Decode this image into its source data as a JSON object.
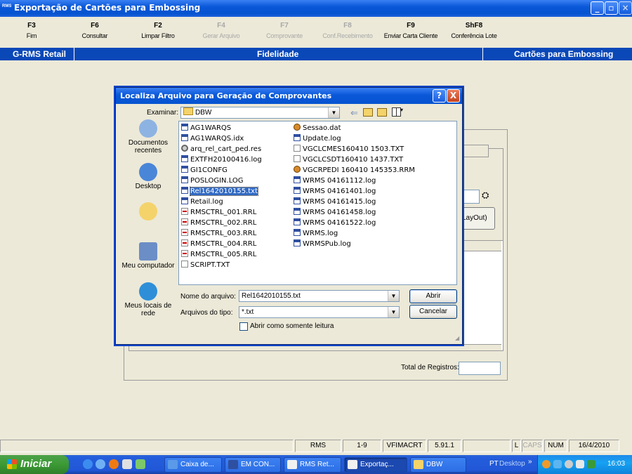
{
  "window": {
    "title": "Exportação de Cartões para Embossing",
    "logo": "RMS"
  },
  "function_keys": [
    {
      "key": "F3",
      "label": "Fim",
      "enabled": true
    },
    {
      "key": "F6",
      "label": "Consultar",
      "enabled": true
    },
    {
      "key": "F2",
      "label": "Limpar Filtro",
      "enabled": true
    },
    {
      "key": "F4",
      "label": "Gerar Arquivo",
      "enabled": false
    },
    {
      "key": "F7",
      "label": "Comprovante",
      "enabled": false
    },
    {
      "key": "F8",
      "label": "Conf.Recebimento",
      "enabled": false
    },
    {
      "key": "F9",
      "label": "Enviar Carta Cliente",
      "enabled": true
    },
    {
      "key": "ShF8",
      "label": "Conferência Lote",
      "enabled": true
    }
  ],
  "band": {
    "left": "G-RMS Retail",
    "center": "Fidelidade",
    "right": "Cartões para Embossing"
  },
  "background_form": {
    "layout_button": "LayOut)",
    "total_label": "Total de Registros:"
  },
  "dialog": {
    "title": "Localiza Arquivo para Geração de Comprovantes",
    "help": "?",
    "close": "X",
    "look_in_label": "Examinar:",
    "look_in_value": "DBW",
    "places": [
      {
        "label": "Documentos recentes",
        "icon": "recent-documents-icon"
      },
      {
        "label": "Desktop",
        "icon": "desktop-icon"
      },
      {
        "label": "",
        "icon": "my-documents-icon"
      },
      {
        "label": "Meu computador",
        "icon": "my-computer-icon"
      },
      {
        "label": "Meus locais de rede",
        "icon": "network-places-icon"
      }
    ],
    "files_col1": [
      {
        "name": "AG1WARQS",
        "icon": "log"
      },
      {
        "name": "AG1WARQS.idx",
        "icon": "log"
      },
      {
        "name": "arq_rel_cart_ped.res",
        "icon": "gear"
      },
      {
        "name": "EXTFH20100416.log",
        "icon": "log"
      },
      {
        "name": "GI1CONFG",
        "icon": "log"
      },
      {
        "name": "POSLOGIN.LOG",
        "icon": "log"
      },
      {
        "name": "Rel1642010155.txt",
        "icon": "log",
        "selected": true
      },
      {
        "name": "Retail.log",
        "icon": "log"
      },
      {
        "name": "RMSCTRL_001.RRL",
        "icon": "rrl"
      },
      {
        "name": "RMSCTRL_002.RRL",
        "icon": "rrl"
      },
      {
        "name": "RMSCTRL_003.RRL",
        "icon": "rrl"
      },
      {
        "name": "RMSCTRL_004.RRL",
        "icon": "rrl"
      },
      {
        "name": "RMSCTRL_005.RRL",
        "icon": "rrl"
      },
      {
        "name": "SCRIPT.TXT",
        "icon": "txt"
      }
    ],
    "files_col2": [
      {
        "name": "Sessao.dat",
        "icon": "fav"
      },
      {
        "name": "Update.log",
        "icon": "log"
      },
      {
        "name": "VGCLCMES160410 1503.TXT",
        "icon": "txt"
      },
      {
        "name": "VGCLCSDT160410 1437.TXT",
        "icon": "txt"
      },
      {
        "name": "VGCRPEDI 160410 145353.RRM",
        "icon": "fav"
      },
      {
        "name": "WRMS 04161112.log",
        "icon": "log"
      },
      {
        "name": "WRMS 04161401.log",
        "icon": "log"
      },
      {
        "name": "WRMS 04161415.log",
        "icon": "log"
      },
      {
        "name": "WRMS 04161458.log",
        "icon": "log"
      },
      {
        "name": "WRMS 04161522.log",
        "icon": "log"
      },
      {
        "name": "WRMS.log",
        "icon": "log"
      },
      {
        "name": "WRMSPub.log",
        "icon": "log"
      }
    ],
    "filename_label": "Nome do arquivo:",
    "filename_value": "Rel1642010155.txt",
    "filetype_label": "Arquivos do tipo:",
    "filetype_value": "*.txt",
    "readonly_label": "Abrir como somente leitura",
    "open_button": "Abrir",
    "cancel_button": "Cancelar"
  },
  "status_bar": {
    "cells": [
      "RMS",
      "1-9",
      "VFIMACRT",
      "5.91.1",
      "L",
      "CAPS",
      "NUM",
      "16/4/2010"
    ]
  },
  "taskbar": {
    "start": "Iniciar",
    "tasks": [
      "Caixa de...",
      "EM CON...",
      "RMS Ret...",
      "Exportaç...",
      "DBW"
    ],
    "lang": "PT",
    "desktop": "Desktop",
    "clock": "16:03"
  }
}
